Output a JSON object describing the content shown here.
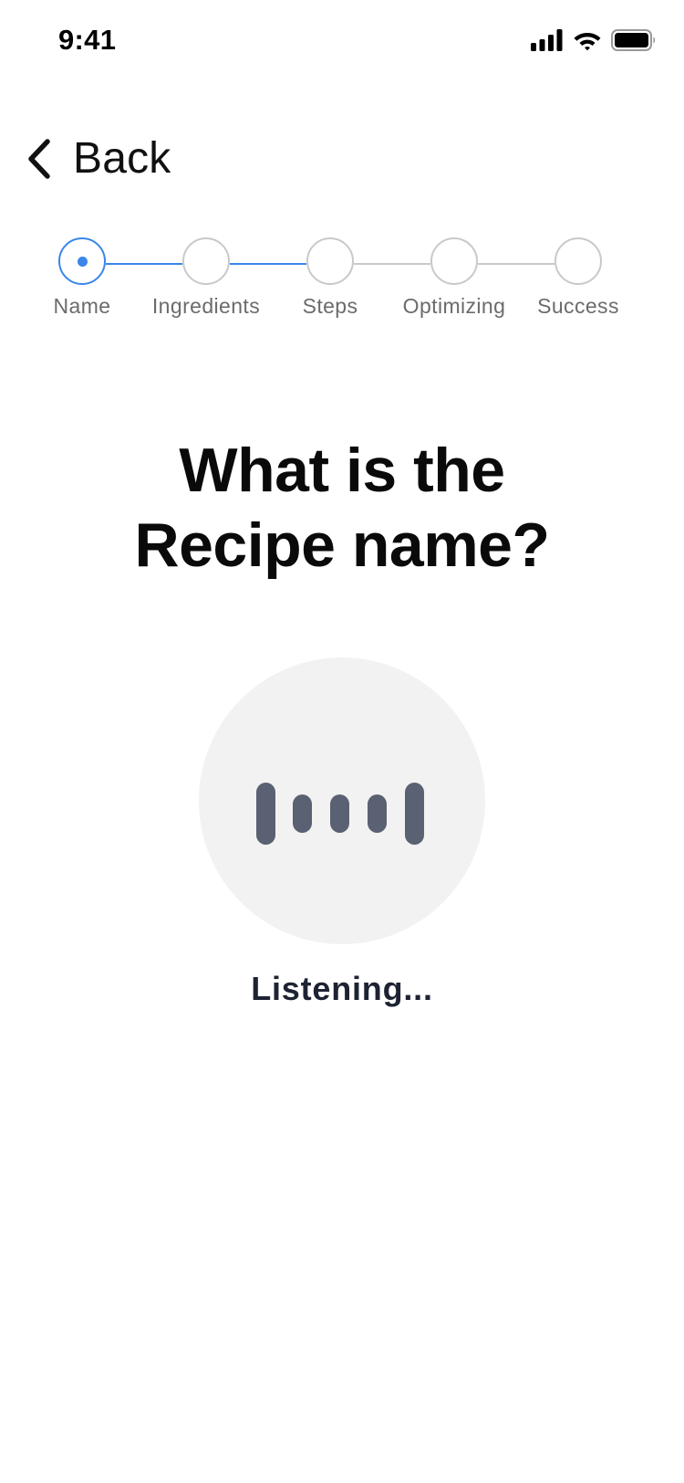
{
  "status_bar": {
    "time": "9:41",
    "icons": [
      "cellular-signal-icon",
      "wifi-icon",
      "battery-icon"
    ]
  },
  "nav": {
    "back_label": "Back",
    "back_icon": "chevron-left-icon"
  },
  "stepper": {
    "current_step": 0,
    "steps": [
      {
        "label": "Name",
        "state": "active"
      },
      {
        "label": "Ingredients",
        "state": "upcoming"
      },
      {
        "label": "Steps",
        "state": "upcoming"
      },
      {
        "label": "Optimizing",
        "state": "upcoming"
      },
      {
        "label": "Success",
        "state": "upcoming"
      }
    ],
    "colors": {
      "active": "#3a86ea",
      "inactive": "#c9c9c9",
      "label": "#6b6b6b"
    }
  },
  "prompt": {
    "title_line1": "What is the",
    "title_line2": "Recipe name?"
  },
  "voice": {
    "icon": "audio-waveform-icon",
    "status": "Listening..."
  }
}
